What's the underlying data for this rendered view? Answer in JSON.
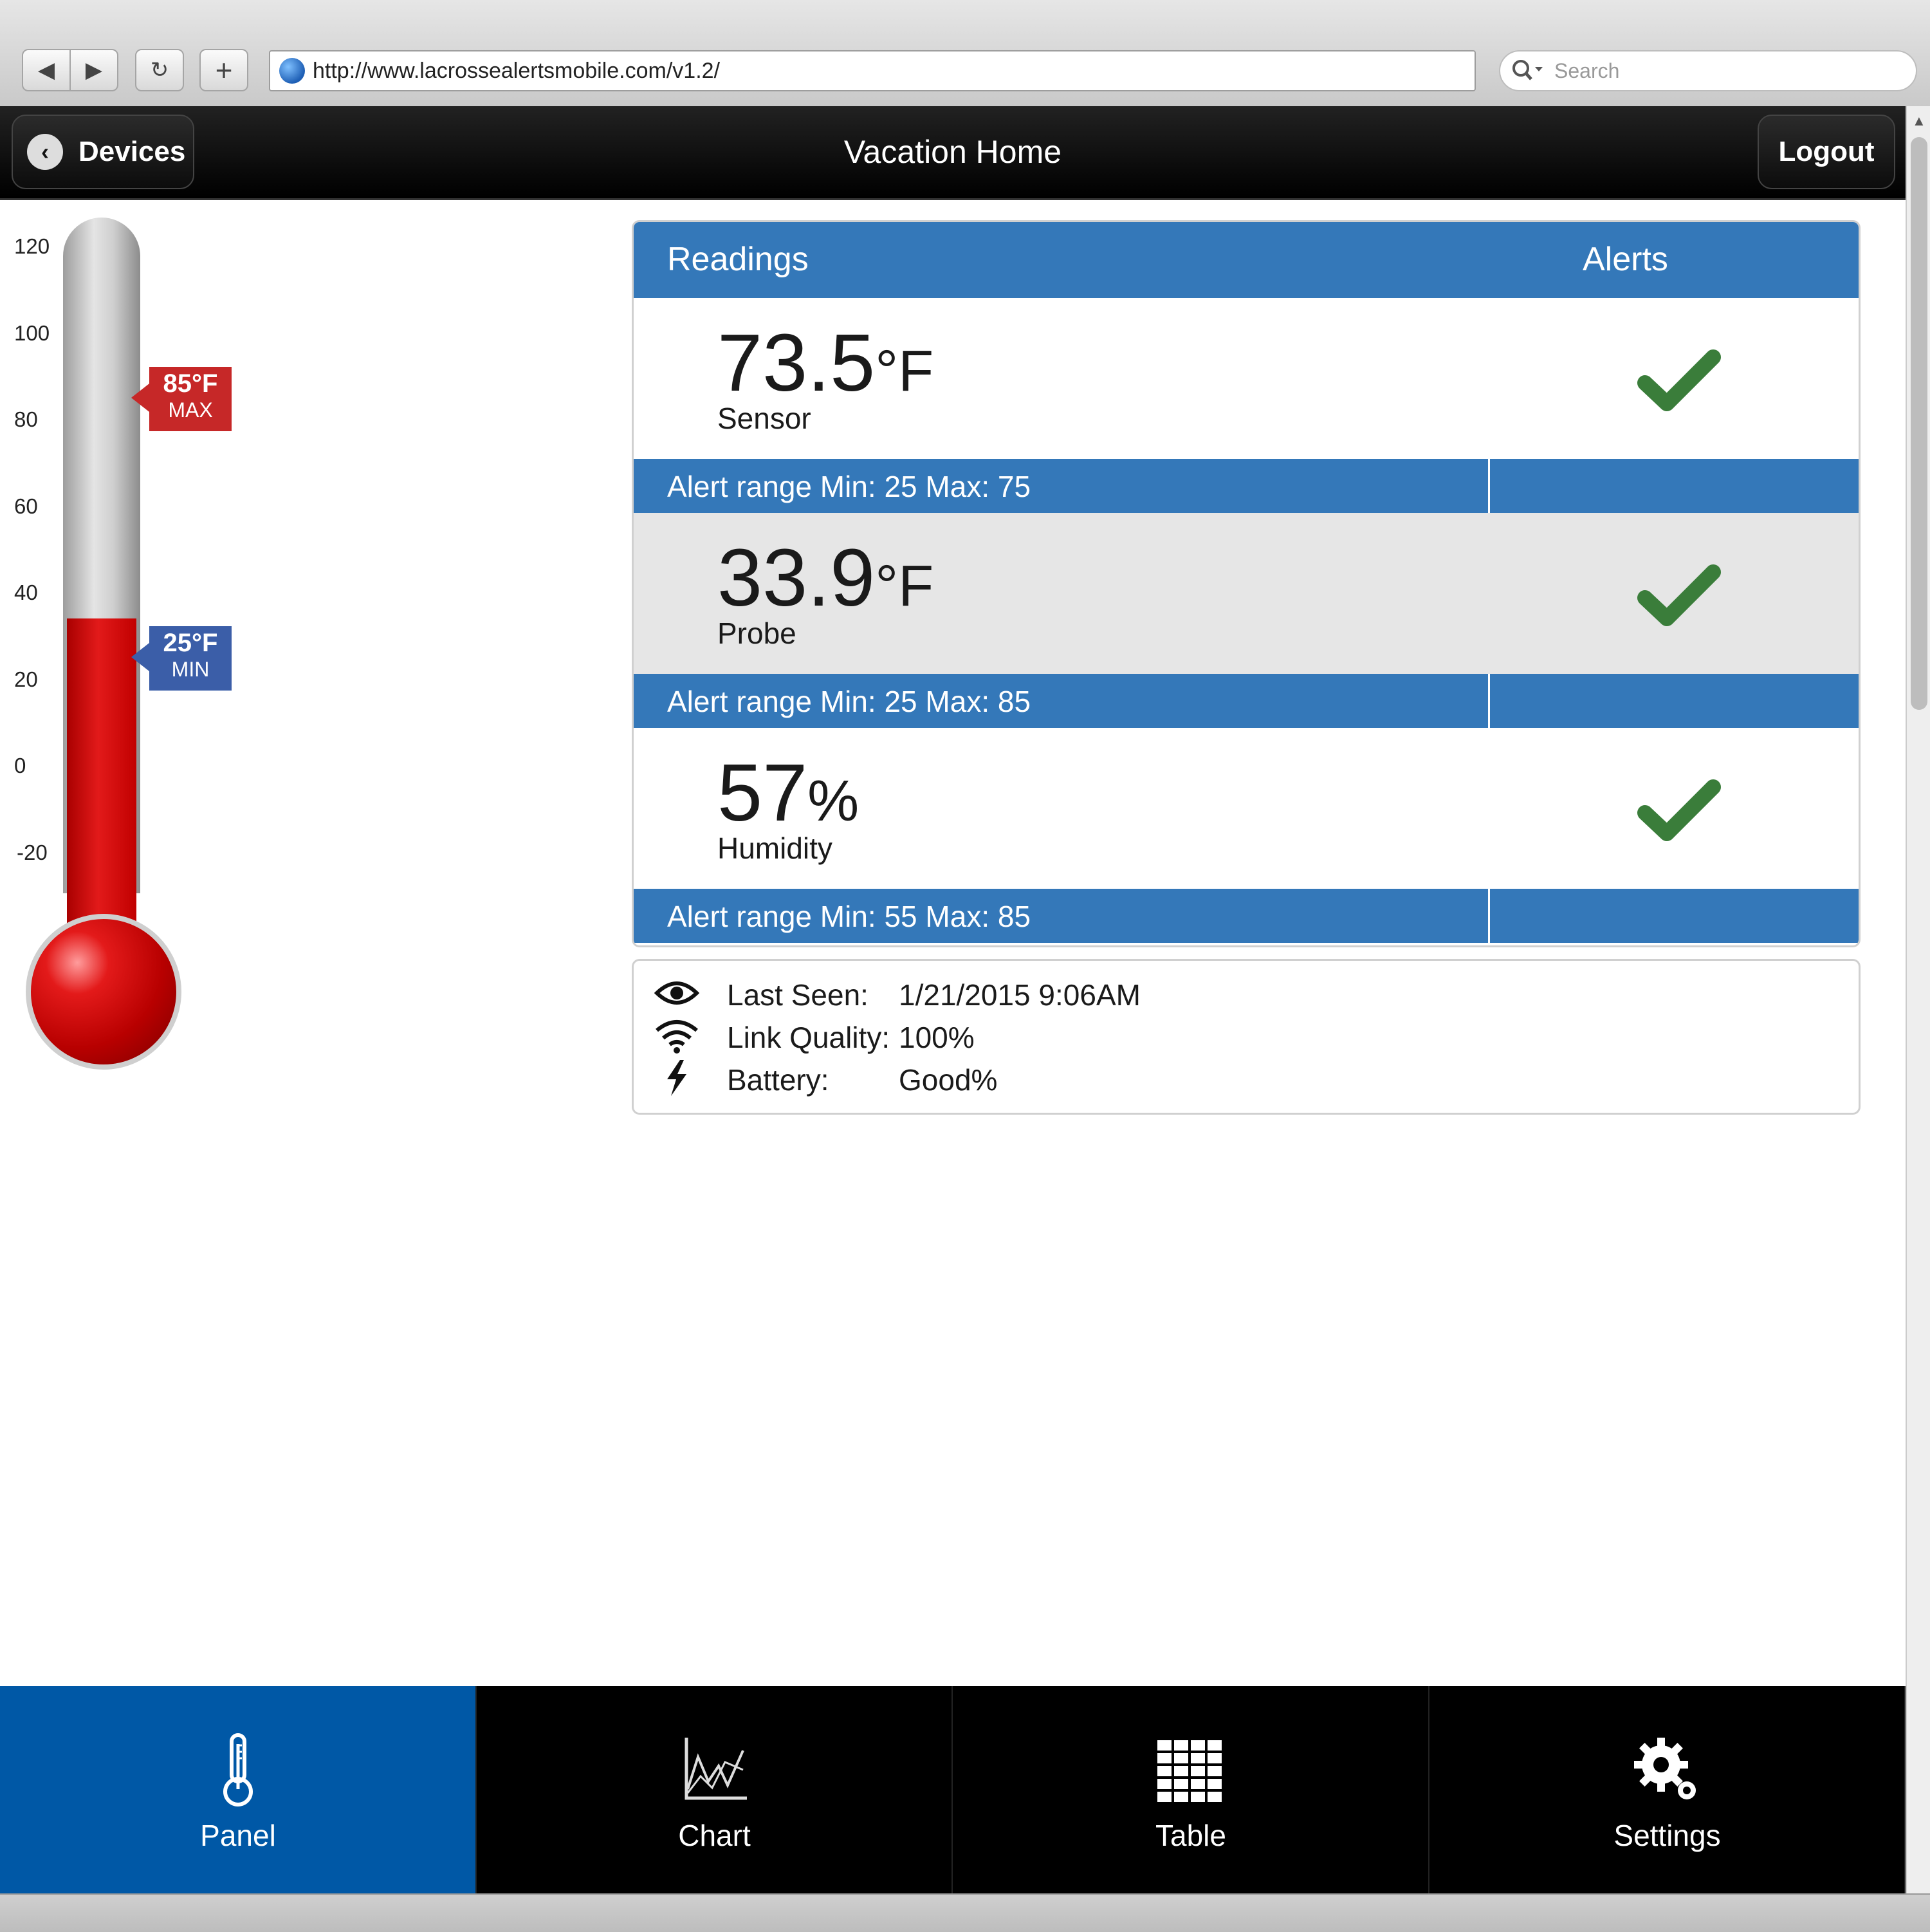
{
  "browser": {
    "url": "http://www.lacrossealertsmobile.com/v1.2/",
    "search_placeholder": "Search",
    "back_icon": "◀",
    "forward_icon": "▶",
    "reload_icon": "↻",
    "new_tab_icon": "+"
  },
  "header": {
    "back_label": "Devices",
    "title": "Vacation Home",
    "logout_label": "Logout"
  },
  "thermometer": {
    "ticks": [
      "120",
      "100",
      "80",
      "60",
      "40",
      "20",
      "0",
      "-20"
    ],
    "current_level_f": 33.9,
    "max_flag": {
      "value": "85°F",
      "label": "MAX",
      "color": "#c62828"
    },
    "min_flag": {
      "value": "25°F",
      "label": "MIN",
      "color": "#3b5ea8"
    }
  },
  "readings": {
    "header_readings": "Readings",
    "header_alerts": "Alerts",
    "items": [
      {
        "value": "73.5",
        "unit": "°F",
        "name": "Sensor",
        "alert_ok": true,
        "range": "Alert range Min: 25  Max: 75"
      },
      {
        "value": "33.9",
        "unit": "°F",
        "name": "Probe",
        "alert_ok": true,
        "range": "Alert range Min: 25  Max: 85"
      },
      {
        "value": "57",
        "unit": "%",
        "name": "Humidity",
        "alert_ok": true,
        "range": "Alert range Min: 55  Max: 85"
      }
    ]
  },
  "status": {
    "last_seen_label": "Last Seen:",
    "last_seen_value": "1/21/2015 9:06AM",
    "link_quality_label": "Link Quality:",
    "link_quality_value": "100%",
    "battery_label": "Battery:",
    "battery_value": "Good%"
  },
  "tabs": [
    {
      "label": "Panel",
      "icon": "thermometer-icon",
      "active": true
    },
    {
      "label": "Chart",
      "icon": "chart-icon",
      "active": false
    },
    {
      "label": "Table",
      "icon": "table-icon",
      "active": false
    },
    {
      "label": "Settings",
      "icon": "gear-icon",
      "active": false
    }
  ],
  "colors": {
    "accent_blue": "#3478b9",
    "active_tab": "#0058a6",
    "check_green": "#3a7d3a",
    "thermo_red": "#d40000"
  }
}
